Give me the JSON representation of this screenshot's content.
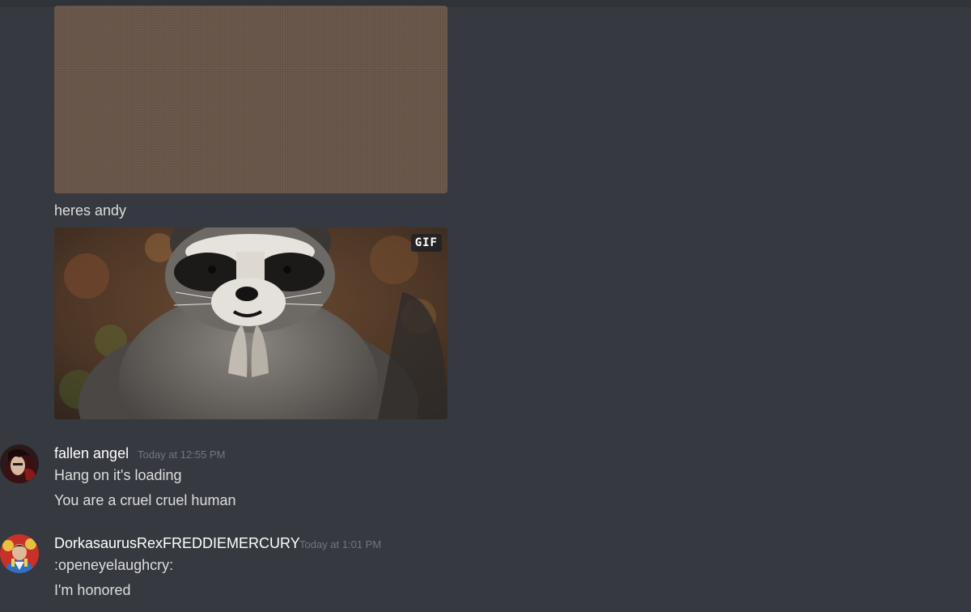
{
  "messages": {
    "caption": "heres andy",
    "gif_badge": "GIF",
    "group1": {
      "username": "fallen angel",
      "timestamp": "Today at 12:55 PM",
      "lines": [
        "Hang on it's loading",
        "You are a cruel cruel human"
      ]
    },
    "group2": {
      "username": "DorkasaurusRexFREDDIEMERCURY",
      "timestamp": "Today at 1:01 PM",
      "lines": [
        ":openeyelaughcry:",
        "I'm honored"
      ]
    }
  },
  "colors": {
    "background": "#36393f",
    "text": "#dcddde",
    "username": "#ffffff",
    "timestamp": "#72767d"
  },
  "icons": {
    "avatar1": "fallen-angel-avatar",
    "avatar2": "dorkasaurus-avatar"
  }
}
